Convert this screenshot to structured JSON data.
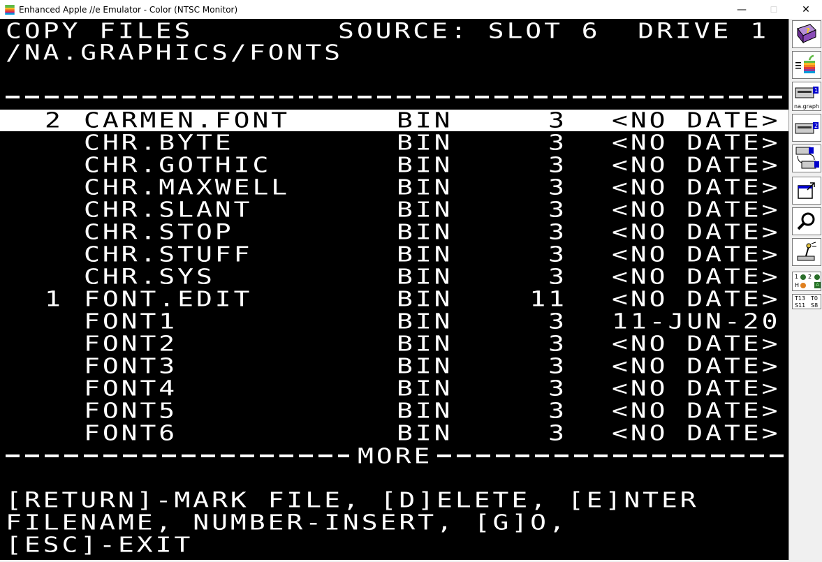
{
  "window": {
    "title": "Enhanced Apple //e Emulator - Color (NTSC Monitor)",
    "minimize": "—",
    "maximize": "☐",
    "close": "✕"
  },
  "header": {
    "title": "COPY FILES",
    "source": "SOURCE: SLOT 6  DRIVE 1",
    "path": "/NA.GRAPHICS/FONTS"
  },
  "files": [
    {
      "mark": "2",
      "name": "CARMEN.FONT",
      "type": "BIN",
      "blocks": "3",
      "date": "<NO DATE>",
      "selected": true
    },
    {
      "mark": "",
      "name": "CHR.BYTE",
      "type": "BIN",
      "blocks": "3",
      "date": "<NO DATE>"
    },
    {
      "mark": "",
      "name": "CHR.GOTHIC",
      "type": "BIN",
      "blocks": "3",
      "date": "<NO DATE>"
    },
    {
      "mark": "",
      "name": "CHR.MAXWELL",
      "type": "BIN",
      "blocks": "3",
      "date": "<NO DATE>"
    },
    {
      "mark": "",
      "name": "CHR.SLANT",
      "type": "BIN",
      "blocks": "3",
      "date": "<NO DATE>"
    },
    {
      "mark": "",
      "name": "CHR.STOP",
      "type": "BIN",
      "blocks": "3",
      "date": "<NO DATE>"
    },
    {
      "mark": "",
      "name": "CHR.STUFF",
      "type": "BIN",
      "blocks": "3",
      "date": "<NO DATE>"
    },
    {
      "mark": "",
      "name": "CHR.SYS",
      "type": "BIN",
      "blocks": "3",
      "date": "<NO DATE>"
    },
    {
      "mark": "1",
      "name": "FONT.EDIT",
      "type": "BIN",
      "blocks": "11",
      "date": "<NO DATE>"
    },
    {
      "mark": "",
      "name": "FONT1",
      "type": "BIN",
      "blocks": "3",
      "date": "11-JUN-20"
    },
    {
      "mark": "",
      "name": "FONT2",
      "type": "BIN",
      "blocks": "3",
      "date": "<NO DATE>"
    },
    {
      "mark": "",
      "name": "FONT3",
      "type": "BIN",
      "blocks": "3",
      "date": "<NO DATE>"
    },
    {
      "mark": "",
      "name": "FONT4",
      "type": "BIN",
      "blocks": "3",
      "date": "<NO DATE>"
    },
    {
      "mark": "",
      "name": "FONT5",
      "type": "BIN",
      "blocks": "3",
      "date": "<NO DATE>"
    },
    {
      "mark": "",
      "name": "FONT6",
      "type": "BIN",
      "blocks": "3",
      "date": "<NO DATE>"
    }
  ],
  "more_label": "MORE",
  "instructions": [
    "[RETURN]-MARK FILE, [D]ELETE, [E]NTER",
    "FILENAME, NUMBER-INSERT, [G]O,",
    "[ESC]-EXIT"
  ],
  "toolbar": {
    "drive1_label": "na.graph",
    "drive1_num": "1",
    "drive2_num": "2",
    "led_1": "1",
    "led_2": "2",
    "led_h": "H",
    "led_a": "A",
    "track_t1": "T13",
    "track_t2": "T0",
    "sector_s1": "S11",
    "sector_s2": "S8"
  },
  "colors": {
    "screen_bg": "#000000",
    "screen_fg": "#ffffff",
    "toolbar_bg": "#f0f0f0",
    "help_purple": "#6a2c91",
    "drive_blue": "#0000cc"
  }
}
